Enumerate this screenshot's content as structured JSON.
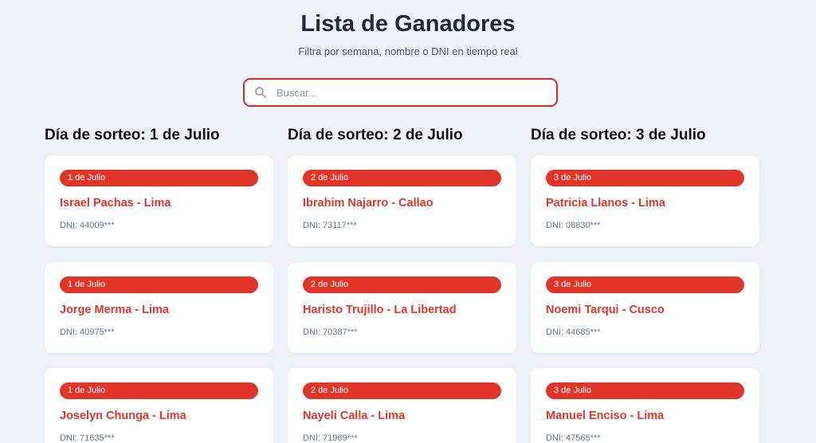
{
  "header": {
    "title": "Lista de Ganadores",
    "subtitle": "Filtra por semana, nombre o DNI en tiempo real"
  },
  "search": {
    "placeholder": "Buscar...",
    "value": ""
  },
  "columns": [
    {
      "title": "Día de sorteo: 1 de Julio",
      "cards": [
        {
          "badge": "1 de Julio",
          "name": "Israel Pachas - Lima",
          "dni": "DNI: 44009***"
        },
        {
          "badge": "1 de Julio",
          "name": "Jorge Merma - Lima",
          "dni": "DNI: 40975***"
        },
        {
          "badge": "1 de Julio",
          "name": "Joselyn Chunga - Lima",
          "dni": "DNI: 71635***"
        }
      ]
    },
    {
      "title": "Día de sorteo: 2 de Julio",
      "cards": [
        {
          "badge": "2 de Julio",
          "name": "Ibrahim Najarro - Callao",
          "dni": "DNI: 73117***"
        },
        {
          "badge": "2 de Julio",
          "name": "Haristo Trujillo - La Libertad",
          "dni": "DNI: 70387***"
        },
        {
          "badge": "2 de Julio",
          "name": "Nayeli Calla - Lima",
          "dni": "DNI: 71969***"
        }
      ]
    },
    {
      "title": "Día de sorteo: 3 de Julio",
      "cards": [
        {
          "badge": "3 de Julio",
          "name": "Patricia Llanos - Lima",
          "dni": "DNI: 08830***"
        },
        {
          "badge": "3 de Julio",
          "name": "Noemi Tarqui - Cusco",
          "dni": "DNI: 44685***"
        },
        {
          "badge": "3 de Julio",
          "name": "Manuel Enciso - Lima",
          "dni": "DNI: 47565***"
        }
      ]
    }
  ],
  "colors": {
    "accent": "#e0362a",
    "background": "#eef2f7",
    "title": "#1e2a3b"
  },
  "icons": {
    "search": "search-icon"
  }
}
